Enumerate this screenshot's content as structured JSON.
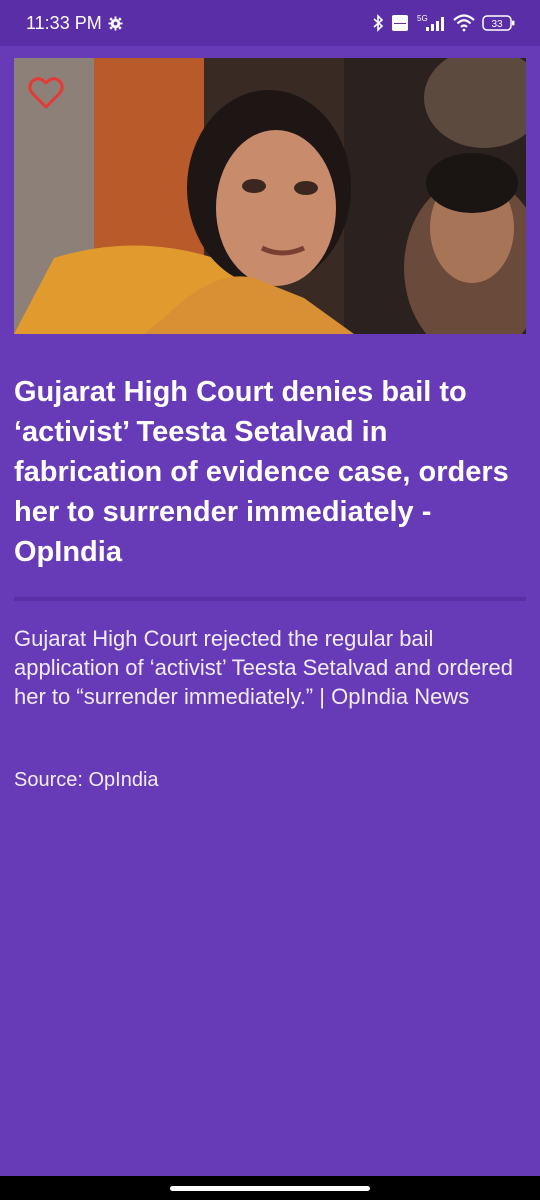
{
  "status_bar": {
    "time": "11:33 PM",
    "network": "5G",
    "battery": "33",
    "icons": [
      "settings-gear-icon",
      "bluetooth-icon",
      "volte-icon",
      "signal-icon",
      "wifi-icon",
      "battery-icon"
    ]
  },
  "article": {
    "headline": "Gujarat High Court denies bail to ‘activist’ Teesta Setalvad in fabrication of evidence case, orders her to surrender immediately - OpIndia",
    "description": "Gujarat High Court rejected the regular bail application of ‘activist’ Teesta Setalvad and ordered her to “surrender immediately.” | OpIndia News",
    "source": "Source: OpIndia",
    "favorite_icon": "heart-outline-icon"
  },
  "colors": {
    "background": "#673ab7",
    "status_bar": "#5a2ea6",
    "heart": "#e53935"
  }
}
